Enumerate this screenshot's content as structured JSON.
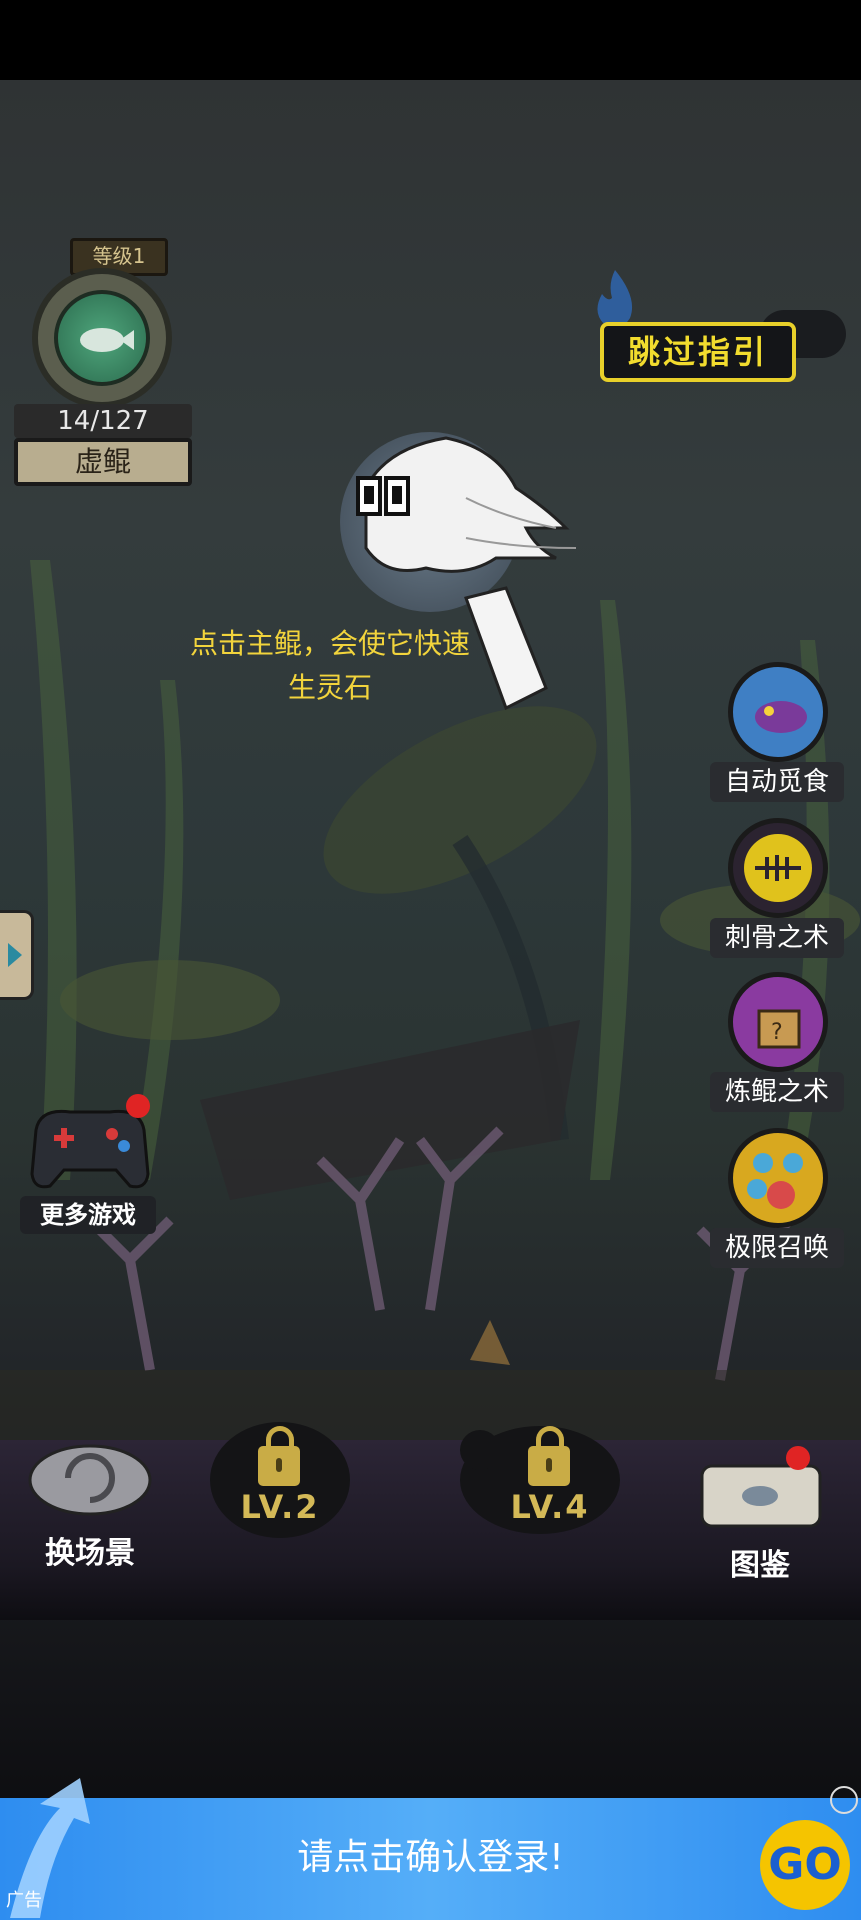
{
  "hud": {
    "level_tag": "等级1",
    "progress": "14/127",
    "name": "虚鲲"
  },
  "skip_guide": "跳过指引",
  "hint": {
    "line1": "点击主鲲，会使它快速",
    "line2": "生灵石"
  },
  "side_buttons": [
    {
      "label": "自动觅食",
      "icon": "fish-eating-icon",
      "color": "#3f7fc4"
    },
    {
      "label": "刺骨之术",
      "icon": "fish-bone-icon",
      "color": "#6a2b8a"
    },
    {
      "label": "炼鲲之术",
      "icon": "mystery-box-icon",
      "color": "#8a3aa0"
    },
    {
      "label": "极限召唤",
      "icon": "fish-group-icon",
      "color": "#d8a81f"
    }
  ],
  "more_games": "更多游戏",
  "dock": {
    "change_scene": "换场景",
    "lock1": "LV.2",
    "lock2": "LV.4",
    "guide": "图鉴"
  },
  "ad": {
    "text": "请点击确认登录!",
    "go": "GO",
    "tag": "广告"
  }
}
